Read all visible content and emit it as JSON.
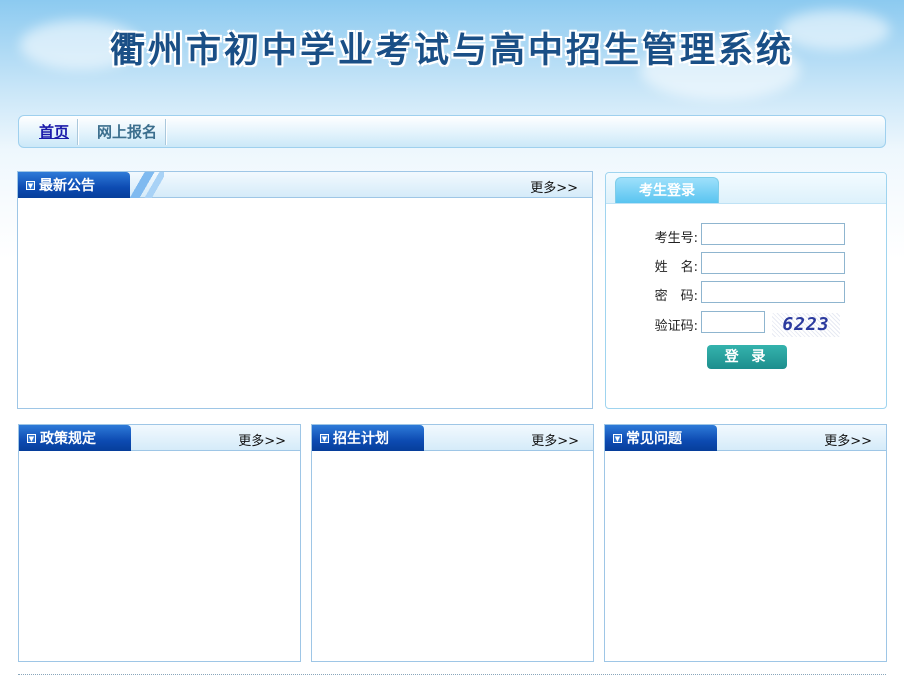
{
  "header": {
    "title": "衢州市初中学业考试与高中招生管理系统"
  },
  "nav": {
    "items": [
      {
        "label": "首页",
        "active": true
      },
      {
        "label": "网上报名",
        "active": false
      }
    ]
  },
  "panels": {
    "announcements": {
      "title": "最新公告",
      "more": "更多>>"
    },
    "policy": {
      "title": "政策规定",
      "more": "更多>>"
    },
    "plan": {
      "title": "招生计划",
      "more": "更多>>"
    },
    "faq": {
      "title": "常见问题",
      "more": "更多>>"
    }
  },
  "login": {
    "title": "考生登录",
    "fields": {
      "exam_no": {
        "label": "考生号:",
        "value": ""
      },
      "name": {
        "label": "姓　名:",
        "value": ""
      },
      "password": {
        "label": "密　码:",
        "value": ""
      },
      "captcha": {
        "label": "验证码:",
        "value": "",
        "image_text": "6223"
      }
    },
    "submit_label": "登 录"
  },
  "icons": {
    "tab_marker": "triangle-down-icon"
  },
  "colors": {
    "tab_blue": "#0d4bb2",
    "login_tab": "#59c4f0",
    "login_button": "#1d8e8d",
    "title_blue": "#1a4f86"
  }
}
